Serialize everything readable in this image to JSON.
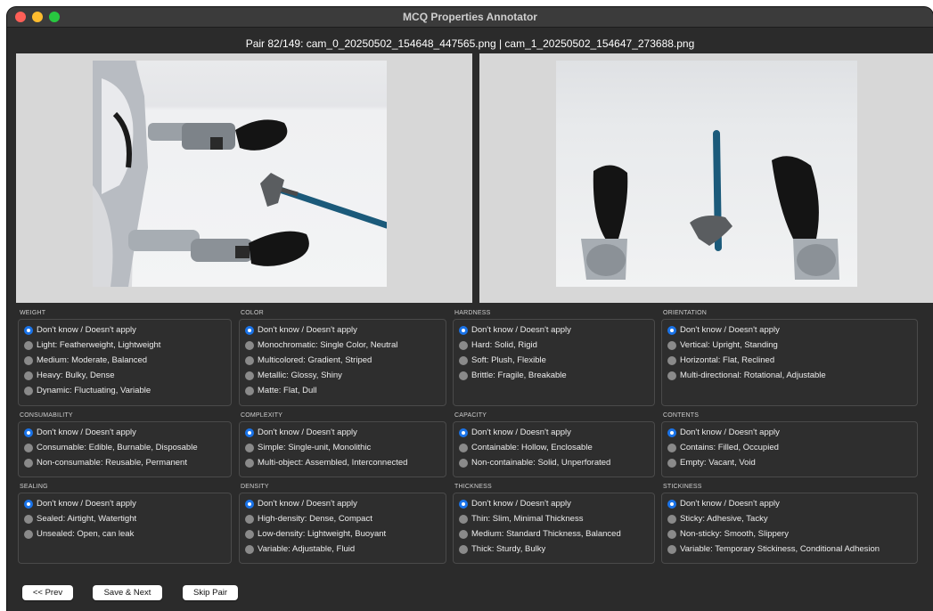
{
  "window": {
    "title": "MCQ Properties Annotator"
  },
  "pair_title": "Pair 82/149: cam_0_20250502_154648_447565.png | cam_1_20250502_154647_273688.png",
  "groups": [
    {
      "label": "WEIGHT",
      "options": [
        "Don't know / Doesn't apply",
        "Light: Featherweight, Lightweight",
        "Medium: Moderate, Balanced",
        "Heavy: Bulky, Dense",
        "Dynamic: Fluctuating, Variable"
      ],
      "selected": 0
    },
    {
      "label": "COLOR",
      "options": [
        "Don't know / Doesn't apply",
        "Monochromatic: Single Color, Neutral",
        "Multicolored: Gradient, Striped",
        "Metallic: Glossy, Shiny",
        "Matte: Flat, Dull"
      ],
      "selected": 0
    },
    {
      "label": "HARDNESS",
      "options": [
        "Don't know / Doesn't apply",
        "Hard: Solid, Rigid",
        "Soft: Plush, Flexible",
        "Brittle: Fragile, Breakable"
      ],
      "selected": 0
    },
    {
      "label": "ORIENTATION",
      "options": [
        "Don't know / Doesn't apply",
        "Vertical: Upright, Standing",
        "Horizontal: Flat, Reclined",
        "Multi-directional: Rotational, Adjustable"
      ],
      "selected": 0
    },
    {
      "label": "CONSUMABILITY",
      "options": [
        "Don't know / Doesn't apply",
        "Consumable: Edible, Burnable, Disposable",
        "Non-consumable: Reusable, Permanent"
      ],
      "selected": 0
    },
    {
      "label": "COMPLEXITY",
      "options": [
        "Don't know / Doesn't apply",
        "Simple: Single-unit, Monolithic",
        "Multi-object: Assembled, Interconnected"
      ],
      "selected": 0
    },
    {
      "label": "CAPACITY",
      "options": [
        "Don't know / Doesn't apply",
        "Containable: Hollow, Enclosable",
        "Non-containable: Solid, Unperforated"
      ],
      "selected": 0
    },
    {
      "label": "CONTENTS",
      "options": [
        "Don't know / Doesn't apply",
        "Contains: Filled, Occupied",
        "Empty: Vacant, Void"
      ],
      "selected": 0
    },
    {
      "label": "SEALING",
      "options": [
        "Don't know / Doesn't apply",
        "Sealed: Airtight, Watertight",
        "Unsealed: Open, can leak"
      ],
      "selected": 0
    },
    {
      "label": "DENSITY",
      "options": [
        "Don't know / Doesn't apply",
        "High-density: Dense, Compact",
        "Low-density: Lightweight, Buoyant",
        "Variable: Adjustable, Fluid"
      ],
      "selected": 0
    },
    {
      "label": "THICKNESS",
      "options": [
        "Don't know / Doesn't apply",
        "Thin: Slim, Minimal Thickness",
        "Medium: Standard Thickness, Balanced",
        "Thick: Sturdy, Bulky"
      ],
      "selected": 0
    },
    {
      "label": "STICKINESS",
      "options": [
        "Don't know / Doesn't apply",
        "Sticky: Adhesive, Tacky",
        "Non-sticky: Smooth, Slippery",
        "Variable: Temporary Stickiness, Conditional Adhesion"
      ],
      "selected": 0
    }
  ],
  "buttons": {
    "prev": "<< Prev",
    "save_next": "Save & Next",
    "skip": "Skip Pair"
  },
  "colors": {
    "window_bg": "#2b2b2b",
    "radio_selected": "#1a73e8",
    "radio_unselected": "#8a8a8a"
  }
}
